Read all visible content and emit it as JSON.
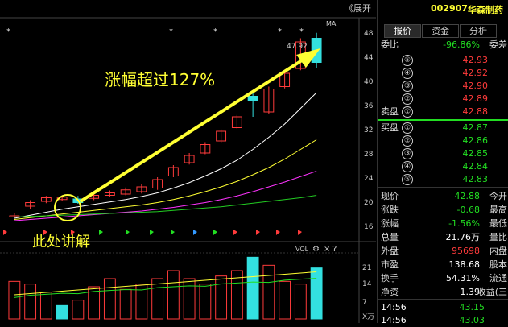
{
  "chart_top": {
    "expand_label": "《展开",
    "ma_label": "MA",
    "price_label": "47.92",
    "annotation_rise": "涨幅超过127%",
    "annotation_here": "此处讲解",
    "vol_label": "VOL",
    "vol_icons": [
      "gear-icon",
      "close-icon",
      "help-icon"
    ],
    "y_axis": [
      "48",
      "44",
      "40",
      "36",
      "32",
      "28",
      "24",
      "20",
      "16"
    ],
    "vol_axis": [
      "21",
      "14",
      "7",
      "X万"
    ]
  },
  "panel": {
    "code": "002907",
    "name": "华森制药",
    "tabs": [
      "报价",
      "资金",
      "分析"
    ],
    "weibi_label": "委比",
    "weibi_value": "-96.86%",
    "weicha_label": "委差",
    "asks": [
      {
        "n": "⑤",
        "price": "42.93"
      },
      {
        "n": "④",
        "price": "42.92"
      },
      {
        "n": "③",
        "price": "42.90"
      },
      {
        "n": "②",
        "price": "42.89"
      },
      {
        "n": "①",
        "price": "42.88",
        "label": "卖盘"
      }
    ],
    "bids": [
      {
        "n": "①",
        "price": "42.87",
        "label": "买盘"
      },
      {
        "n": "②",
        "price": "42.86"
      },
      {
        "n": "③",
        "price": "42.85"
      },
      {
        "n": "④",
        "price": "42.84"
      },
      {
        "n": "⑤",
        "price": "42.83"
      }
    ],
    "stats": [
      {
        "l": "现价",
        "v": "42.88",
        "r": "今开",
        "c": "green"
      },
      {
        "l": "涨跌",
        "v": "-0.68",
        "r": "最高",
        "c": "green"
      },
      {
        "l": "涨幅",
        "v": "-1.56%",
        "r": "最低",
        "c": "green"
      },
      {
        "l": "总量",
        "v": "21.76万",
        "r": "量比",
        "c": "white"
      },
      {
        "l": "外盘",
        "v": "95698",
        "r": "内盘",
        "c": "red"
      },
      {
        "l": "市盈",
        "v": "138.68",
        "r": "股本",
        "c": "white"
      },
      {
        "l": "换手",
        "v": "54.31%",
        "r": "流通",
        "c": "white"
      },
      {
        "l": "净资",
        "v": "1.39",
        "r": "收益(三",
        "c": "white"
      }
    ],
    "ticks": [
      {
        "t": "14:56",
        "p": "43.15"
      },
      {
        "t": "14:56",
        "p": "43.03"
      }
    ]
  },
  "chart_data": {
    "type": "candlestick",
    "y_range": [
      16,
      48
    ],
    "candles": [
      {
        "o": 17.6,
        "c": 17.6,
        "h": 18.0,
        "l": 17.2,
        "up": true
      },
      {
        "o": 19.2,
        "c": 19.8,
        "h": 20.2,
        "l": 18.8,
        "up": true
      },
      {
        "o": 20.0,
        "c": 20.6,
        "h": 20.9,
        "l": 19.7,
        "up": true
      },
      {
        "o": 20.3,
        "c": 20.7,
        "h": 21.0,
        "l": 20.0,
        "up": true
      },
      {
        "o": 19.8,
        "c": 20.4,
        "h": 20.9,
        "l": 19.6,
        "up": false
      },
      {
        "o": 20.5,
        "c": 21.0,
        "h": 21.5,
        "l": 20.2,
        "up": true
      },
      {
        "o": 21.0,
        "c": 21.4,
        "h": 21.8,
        "l": 20.7,
        "up": true
      },
      {
        "o": 21.2,
        "c": 21.9,
        "h": 22.3,
        "l": 21.0,
        "up": true
      },
      {
        "o": 21.6,
        "c": 22.4,
        "h": 22.8,
        "l": 21.3,
        "up": true
      },
      {
        "o": 22.2,
        "c": 23.6,
        "h": 24.0,
        "l": 21.9,
        "up": true
      },
      {
        "o": 24.2,
        "c": 25.6,
        "h": 26.0,
        "l": 24.0,
        "up": true
      },
      {
        "o": 26.4,
        "c": 27.6,
        "h": 28.0,
        "l": 26.1,
        "up": true
      },
      {
        "o": 28.0,
        "c": 29.4,
        "h": 29.8,
        "l": 27.8,
        "up": true
      },
      {
        "o": 30.0,
        "c": 31.6,
        "h": 31.9,
        "l": 29.7,
        "up": true
      },
      {
        "o": 32.2,
        "c": 34.0,
        "h": 34.3,
        "l": 32.0,
        "up": true
      },
      {
        "o": 36.6,
        "c": 37.4,
        "h": 38.2,
        "l": 34.0,
        "up": false
      },
      {
        "o": 34.8,
        "c": 38.6,
        "h": 39.0,
        "l": 34.5,
        "up": true
      },
      {
        "o": 39.0,
        "c": 41.2,
        "h": 41.8,
        "l": 38.7,
        "up": true
      },
      {
        "o": 42.0,
        "c": 46.4,
        "h": 47.0,
        "l": 41.7,
        "up": true
      },
      {
        "o": 47.0,
        "c": 43.0,
        "h": 47.9,
        "l": 42.0,
        "up": false
      }
    ],
    "ma": [
      {
        "color": "#ffffff",
        "values": [
          17.2,
          17.7,
          18.2,
          18.7,
          19.1,
          19.5,
          19.9,
          20.3,
          20.8,
          21.4,
          22.2,
          23.1,
          24.2,
          25.4,
          26.8,
          28.6,
          30.6,
          32.8,
          35.4,
          38.0
        ]
      },
      {
        "color": "#ffff33",
        "values": [
          17.0,
          17.3,
          17.6,
          17.9,
          18.2,
          18.5,
          18.8,
          19.1,
          19.4,
          19.8,
          20.3,
          20.9,
          21.6,
          22.4,
          23.3,
          24.4,
          25.6,
          27.0,
          28.6,
          30.2
        ]
      },
      {
        "color": "#ff33ff",
        "values": [
          16.8,
          17.0,
          17.2,
          17.4,
          17.6,
          17.8,
          18.0,
          18.2,
          18.4,
          18.7,
          19.0,
          19.4,
          19.8,
          20.3,
          20.9,
          21.6,
          22.4,
          23.2,
          24.1,
          25.0
        ]
      },
      {
        "color": "#22cc22",
        "values": [
          17.4,
          17.5,
          17.6,
          17.7,
          17.8,
          17.9,
          18.0,
          18.1,
          18.2,
          18.3,
          18.5,
          18.7,
          18.9,
          19.1,
          19.4,
          19.7,
          20.0,
          20.3,
          20.6,
          21.0
        ]
      }
    ],
    "volume": [
      {
        "v": 14,
        "up": true
      },
      {
        "v": 13,
        "up": true
      },
      {
        "v": 10,
        "up": true
      },
      {
        "v": 5,
        "up": false
      },
      {
        "v": 7,
        "up": true
      },
      {
        "v": 12,
        "up": true
      },
      {
        "v": 15,
        "up": true
      },
      {
        "v": 11,
        "up": true
      },
      {
        "v": 13,
        "up": true
      },
      {
        "v": 15,
        "up": true
      },
      {
        "v": 18,
        "up": true
      },
      {
        "v": 15,
        "up": true
      },
      {
        "v": 13,
        "up": true
      },
      {
        "v": 16,
        "up": true
      },
      {
        "v": 18,
        "up": true
      },
      {
        "v": 23,
        "up": false
      },
      {
        "v": 20,
        "up": true
      },
      {
        "v": 14,
        "up": true
      },
      {
        "v": 13,
        "up": true
      },
      {
        "v": 19,
        "up": false
      }
    ],
    "vol_range": [
      0,
      24
    ]
  }
}
